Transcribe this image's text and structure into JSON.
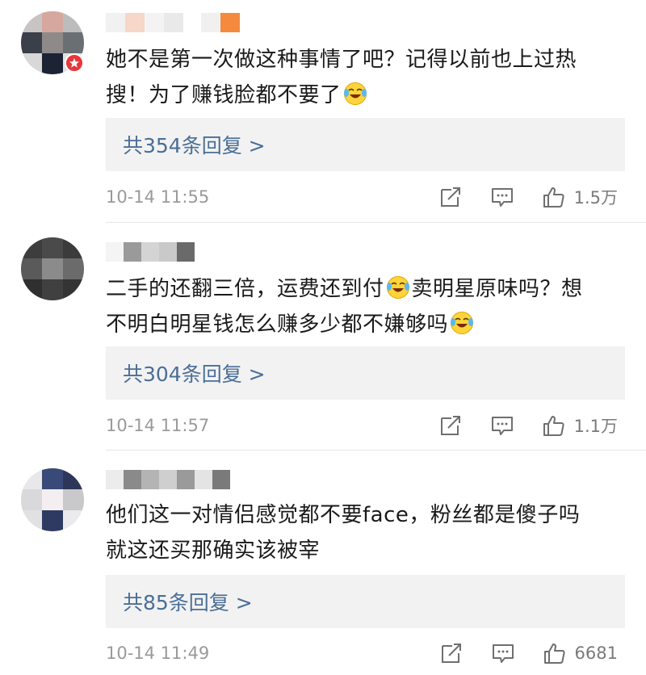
{
  "comments": [
    {
      "text_line1": "她不是第一次做这种事情了吧？记得以前也上过热",
      "text_line2": "搜！为了赚钱脸都不要了",
      "reply_label": "共354条回复 >",
      "timestamp": "10-14 11:55",
      "likes": "1.5万"
    },
    {
      "text_line1_a": "二手的还翻三倍，运费还到付",
      "text_line1_b": "卖明星原味吗？想",
      "text_line2": "不明白明星钱怎么赚多少都不嫌够吗",
      "reply_label": "共304条回复 >",
      "timestamp": "10-14 11:57",
      "likes": "1.1万"
    },
    {
      "text_line1": "他们这一对情侣感觉都不要face，粉丝都是傻子吗",
      "text_line2": "就这还买那确实该被宰",
      "reply_label": "共85条回复 >",
      "timestamp": "10-14 11:49",
      "likes": "6681"
    }
  ],
  "icons": {
    "share": "share-icon",
    "comment": "comment-icon",
    "like": "thumbs-up-icon",
    "emoji": "laughing-crying-emoji",
    "badge": "vip-badge-icon"
  },
  "colors": {
    "reply_link": "#4a6e97",
    "reply_bg": "#f2f2f2",
    "meta_text": "#9a9a9a",
    "badge": "#e8373c"
  }
}
